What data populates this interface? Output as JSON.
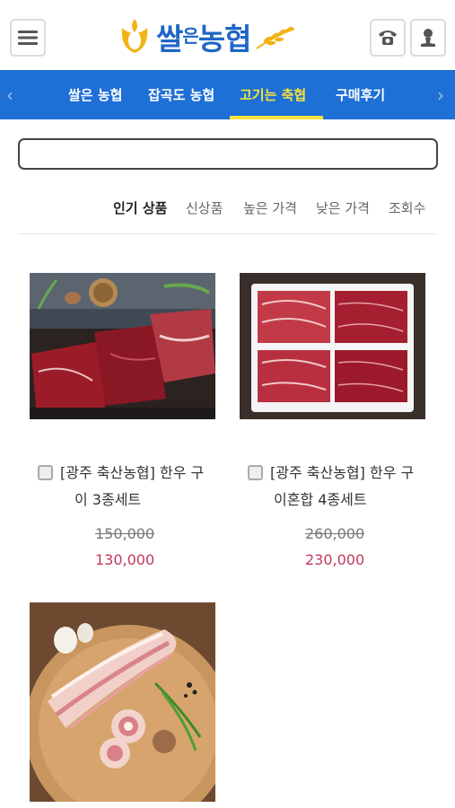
{
  "header": {
    "logo_text_1": "쌀",
    "logo_text_2": "은",
    "logo_text_3": "농협"
  },
  "nav": {
    "items": [
      "쌀은 농협",
      "잡곡도 농협",
      "고기는 축협",
      "구매후기"
    ],
    "active_index": 2
  },
  "search": {
    "value": "",
    "placeholder": ""
  },
  "sort": {
    "options": [
      "인기 상품",
      "신상품",
      "높은 가격",
      "낮은 가격",
      "조회수"
    ],
    "active_index": 0
  },
  "products": [
    {
      "title_line1": "[광주 축산농협] 한우 구",
      "title_line2": "이 3종세트",
      "price_old": "150,000",
      "price_new": "130,000"
    },
    {
      "title_line1": "[광주 축산농협] 한우 구",
      "title_line2": "이혼합 4종세트",
      "price_old": "260,000",
      "price_new": "230,000"
    },
    {
      "title_line1": "",
      "title_line2": "",
      "price_old": "",
      "price_new": ""
    }
  ],
  "colors": {
    "brand_blue": "#1e6fd6",
    "nav_active": "#f6e23a",
    "price_sale": "#c0395a"
  }
}
